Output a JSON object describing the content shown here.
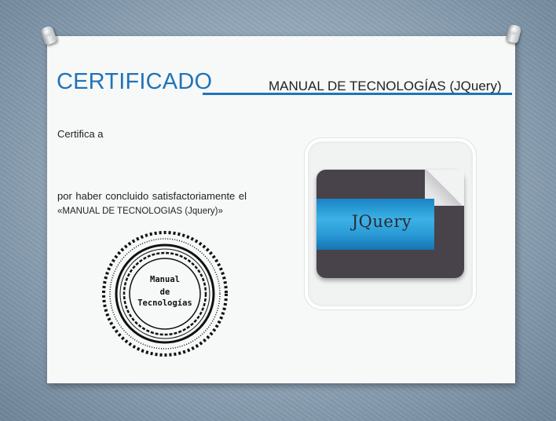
{
  "certificate": {
    "title": "CERTIFICADO",
    "subtitle": "MANUAL DE TECNOLOGÍAS (JQuery)",
    "certifies_label": "Certifica a",
    "body_line1": "por haber concluido  satisfactoriamente el",
    "body_line2": "«MANUAL DE TECNOLOGIAS (Jquery)»"
  },
  "seal": {
    "line1": "Manual",
    "line2": "de",
    "line3": "Tecnologías"
  },
  "logo": {
    "label": "JQuery"
  },
  "colors": {
    "title_blue": "#1f74b8",
    "logo_card": "#48424a",
    "logo_band": "#2a9ad6"
  }
}
